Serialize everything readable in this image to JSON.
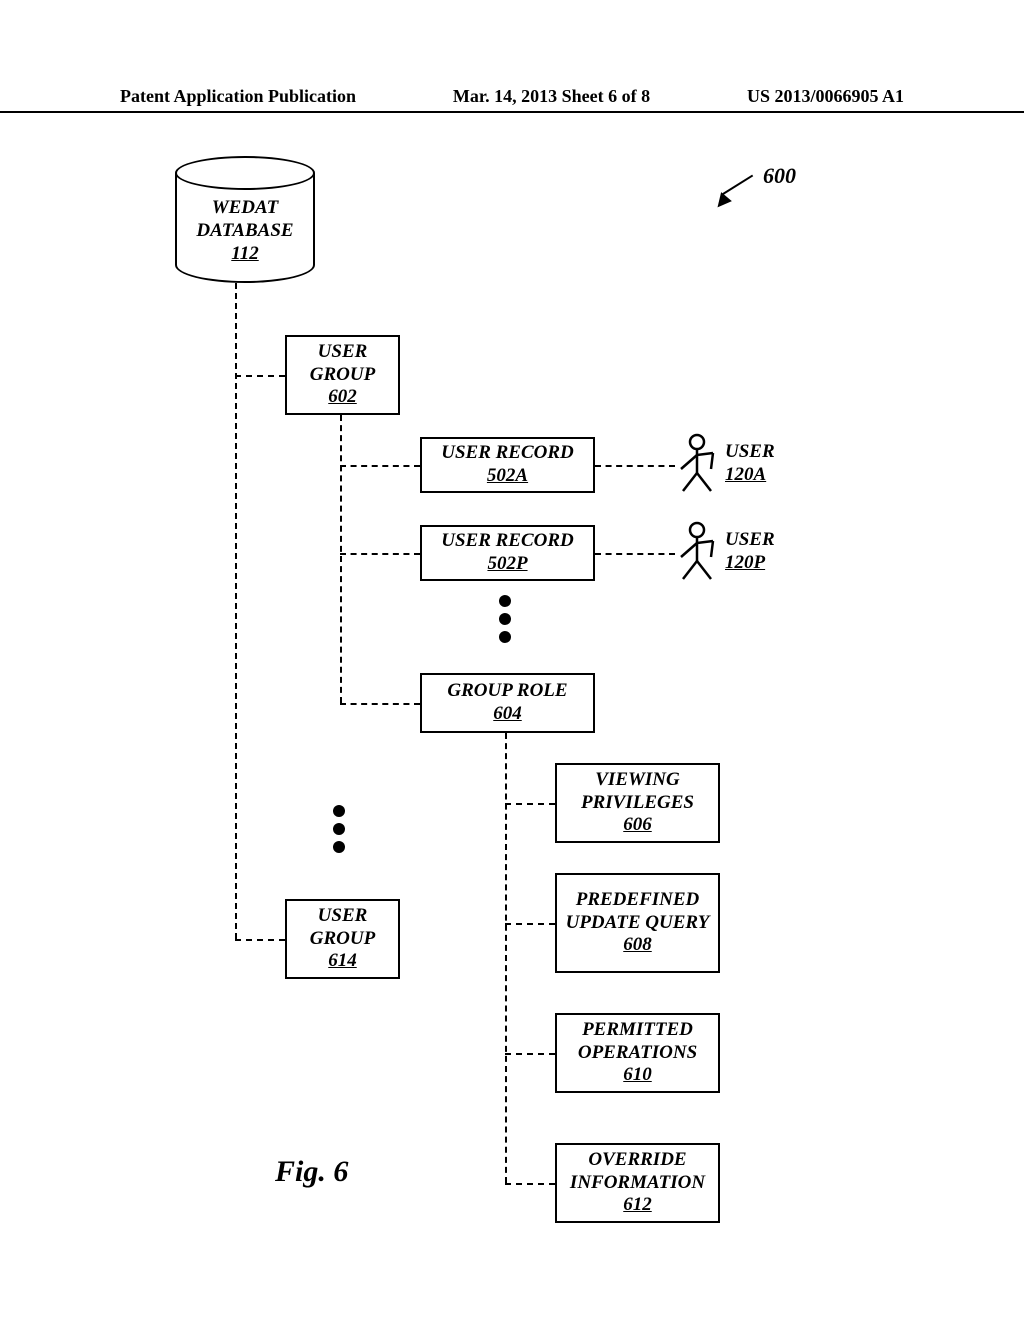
{
  "header": {
    "left": "Patent Application Publication",
    "center": "Mar. 14, 2013  Sheet 6 of 8",
    "right": "US 2013/0066905 A1"
  },
  "figure": {
    "overall_ref": "600",
    "caption": "Fig. 6"
  },
  "nodes": {
    "database": {
      "title": "WEDAT DATABASE",
      "ref": "112"
    },
    "user_group_1": {
      "title": "USER GROUP",
      "ref": "602"
    },
    "user_record_a": {
      "title": "USER RECORD",
      "ref": "502A"
    },
    "user_record_p": {
      "title": "USER RECORD",
      "ref": "502P"
    },
    "group_role": {
      "title": "GROUP ROLE",
      "ref": "604"
    },
    "viewing_privileges": {
      "title": "VIEWING PRIVILEGES",
      "ref": "606"
    },
    "predefined_update_query": {
      "title": "PREDEFINED UPDATE QUERY",
      "ref": "608"
    },
    "permitted_operations": {
      "title": "PERMITTED OPERATIONS",
      "ref": "610"
    },
    "override_information": {
      "title": "OVERRIDE INFORMATION",
      "ref": "612"
    },
    "user_group_2": {
      "title": "USER GROUP",
      "ref": "614"
    },
    "user_a": {
      "title": "USER",
      "ref": "120A"
    },
    "user_p": {
      "title": "USER",
      "ref": "120P"
    }
  }
}
